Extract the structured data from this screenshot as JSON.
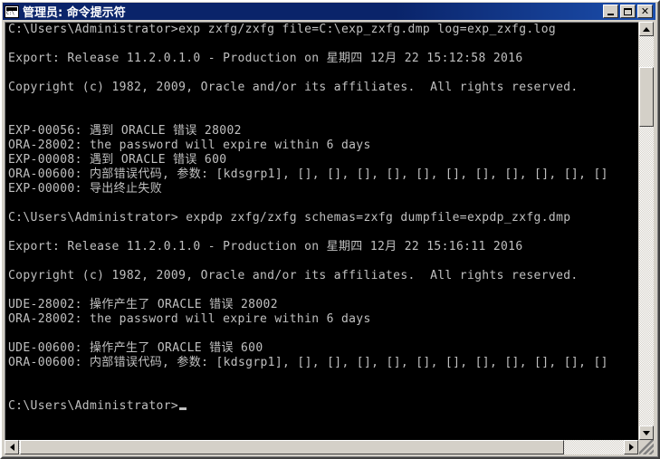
{
  "window": {
    "title": "管理员: 命令提示符",
    "icon": "console-icon",
    "buttons": {
      "minimize": "minimize",
      "maximize": "maximize",
      "close": "close"
    }
  },
  "colors": {
    "titlebar": "#0a246a",
    "titlebar_gradient_end": "#1c4fae",
    "window_chrome": "#d4d0c8",
    "console_background": "#000000",
    "console_text": "#c0c0c0"
  },
  "console": {
    "prompt_path": "C:\\Users\\Administrator>",
    "cursor": "block-underscore-cursor",
    "lines": [
      "C:\\Users\\Administrator>exp zxfg/zxfg file=C:\\exp_zxfg.dmp log=exp_zxfg.log",
      "",
      "Export: Release 11.2.0.1.0 - Production on 星期四 12月 22 15:12:58 2016",
      "",
      "Copyright (c) 1982, 2009, Oracle and/or its affiliates.  All rights reserved.",
      "",
      "",
      "EXP-00056: 遇到 ORACLE 错误 28002",
      "ORA-28002: the password will expire within 6 days",
      "EXP-00008: 遇到 ORACLE 错误 600",
      "ORA-00600: 内部错误代码, 参数: [kdsgrp1], [], [], [], [], [], [], [], [], [], [], []",
      "EXP-00000: 导出终止失败",
      "",
      "C:\\Users\\Administrator> expdp zxfg/zxfg schemas=zxfg dumpfile=expdp_zxfg.dmp",
      "",
      "Export: Release 11.2.0.1.0 - Production on 星期四 12月 22 15:16:11 2016",
      "",
      "Copyright (c) 1982, 2009, Oracle and/or its affiliates.  All rights reserved.",
      "",
      "UDE-28002: 操作产生了 ORACLE 错误 28002",
      "ORA-28002: the password will expire within 6 days",
      "",
      "UDE-00600: 操作产生了 ORACLE 错误 600",
      "ORA-00600: 内部错误代码, 参数: [kdsgrp1], [], [], [], [], [], [], [], [], [], [], []",
      "",
      "",
      "C:\\Users\\Administrator>"
    ]
  },
  "scrollbars": {
    "vertical": {
      "up_arrow": "scroll-up-arrow",
      "down_arrow": "scroll-down-arrow",
      "thumb": "vertical-scroll-thumb"
    },
    "horizontal": {
      "left_arrow": "scroll-left-arrow",
      "right_arrow": "scroll-right-arrow",
      "thumb": "horizontal-scroll-thumb"
    },
    "resize_grip": "resize-grip"
  }
}
